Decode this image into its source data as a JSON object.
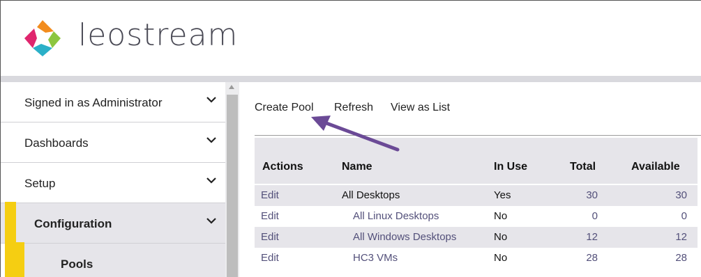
{
  "header": {
    "brand": "leostream",
    "logo_icon": "leostream-logo-icon",
    "colors": {
      "accent": "#f5ce12",
      "link": "#53507a",
      "arrow": "#6b4a96"
    }
  },
  "sidebar": {
    "items": [
      {
        "label": "Signed in as Administrator"
      },
      {
        "label": "Dashboards"
      },
      {
        "label": "Setup"
      },
      {
        "label": "Configuration"
      },
      {
        "label": "Pools"
      }
    ]
  },
  "toolbar": {
    "create_label": "Create Pool",
    "refresh_label": "Refresh",
    "view_label": "View as List"
  },
  "table": {
    "columns": [
      "Actions",
      "Name",
      "In Use",
      "Total",
      "Available"
    ],
    "rows": [
      {
        "action": "Edit",
        "name": "All Desktops",
        "in_use": "Yes",
        "total": "30",
        "available": "30"
      },
      {
        "action": "Edit",
        "name": "All Linux Desktops",
        "in_use": "No",
        "total": "0",
        "available": "0"
      },
      {
        "action": "Edit",
        "name": "All Windows Desktops",
        "in_use": "No",
        "total": "12",
        "available": "12"
      },
      {
        "action": "Edit",
        "name": "HC3 VMs",
        "in_use": "No",
        "total": "28",
        "available": "28"
      }
    ]
  }
}
